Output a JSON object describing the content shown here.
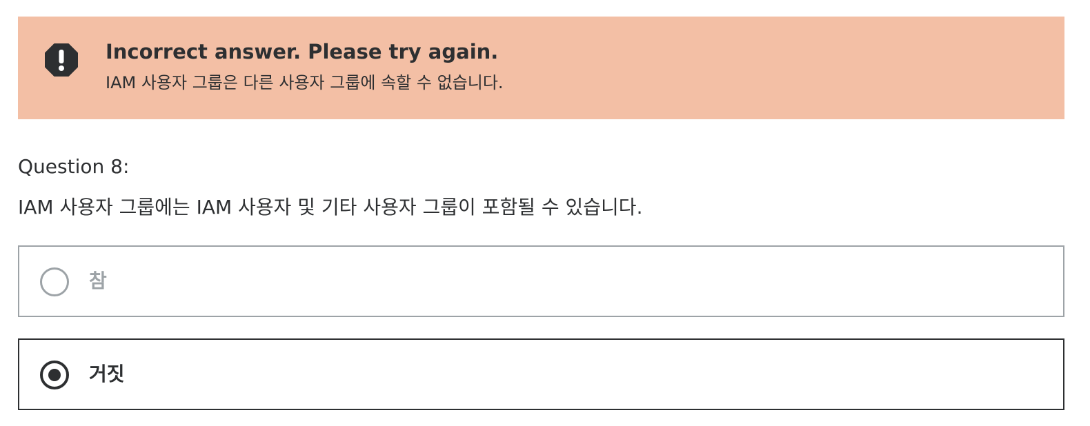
{
  "alert": {
    "status": "incorrect",
    "icon": "alert-octagon-icon",
    "background_color": "#f3bfa5",
    "title": "Incorrect answer. Please try again.",
    "message": "IAM 사용자 그룹은 다른 사용자 그룹에 속할 수 없습니다."
  },
  "question": {
    "number_label": "Question 8:",
    "text": "IAM 사용자 그룹에는 IAM 사용자 및 기타 사용자 그룹이 포함될 수 있습니다.",
    "options": [
      {
        "label": "참",
        "selected": false
      },
      {
        "label": "거짓",
        "selected": true
      }
    ]
  }
}
